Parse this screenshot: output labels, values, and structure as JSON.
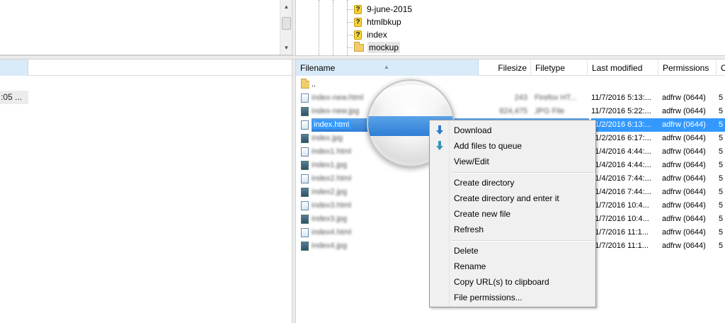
{
  "remote_tree": {
    "items": [
      {
        "label": "9-june-2015",
        "icon": "question-folder-icon"
      },
      {
        "label": "htmlbkup",
        "icon": "question-folder-icon"
      },
      {
        "label": "index",
        "icon": "question-folder-icon"
      },
      {
        "label": "mockup",
        "icon": "folder-icon"
      }
    ]
  },
  "local_list": {
    "cell_text": ":05 ..."
  },
  "file_list": {
    "columns": [
      "Filename",
      "Filesize",
      "Filetype",
      "Last modified",
      "Permissions",
      "O"
    ],
    "rows": [
      {
        "name": "..",
        "size": "",
        "type": "",
        "modified": "",
        "perms": "",
        "owner": "",
        "icon": "folder-icon"
      },
      {
        "name": "index-new.html",
        "size": "243",
        "type": "Firefox HT...",
        "modified": "11/7/2016 5:13:...",
        "perms": "adfrw (0644)",
        "owner": "5",
        "icon": "html-file-icon"
      },
      {
        "name": "index-new.jpg",
        "size": "824,475",
        "type": "JPG File",
        "modified": "11/7/2016 5:22:...",
        "perms": "adfrw (0644)",
        "owner": "5",
        "icon": "image-file-icon"
      },
      {
        "name": "index.html",
        "size": "",
        "type": "",
        "modified": "11/2/2016 6:13:...",
        "perms": "adfrw (0644)",
        "owner": "5",
        "icon": "html-file-icon"
      },
      {
        "name": "index.jpg",
        "size": "",
        "type": "",
        "modified": "11/2/2016 6:17:...",
        "perms": "adfrw (0644)",
        "owner": "5",
        "icon": "image-file-icon"
      },
      {
        "name": "index1.html",
        "size": "",
        "type": "",
        "modified": "11/4/2016 4:44:...",
        "perms": "adfrw (0644)",
        "owner": "5",
        "icon": "html-file-icon"
      },
      {
        "name": "index1.jpg",
        "size": "",
        "type": "",
        "modified": "11/4/2016 4:44:...",
        "perms": "adfrw (0644)",
        "owner": "5",
        "icon": "image-file-icon"
      },
      {
        "name": "index2.html",
        "size": "",
        "type": "",
        "modified": "11/4/2016 7:44:...",
        "perms": "adfrw (0644)",
        "owner": "5",
        "icon": "html-file-icon"
      },
      {
        "name": "index2.jpg",
        "size": "",
        "type": "",
        "modified": "11/4/2016 7:44:...",
        "perms": "adfrw (0644)",
        "owner": "5",
        "icon": "image-file-icon"
      },
      {
        "name": "index3.html",
        "size": "",
        "type": "",
        "modified": "11/7/2016 10:4...",
        "perms": "adfrw (0644)",
        "owner": "5",
        "icon": "html-file-icon"
      },
      {
        "name": "index3.jpg",
        "size": "",
        "type": "",
        "modified": "11/7/2016 10:4...",
        "perms": "adfrw (0644)",
        "owner": "5",
        "icon": "image-file-icon"
      },
      {
        "name": "index4.html",
        "size": "",
        "type": "",
        "modified": "11/7/2016 11:1...",
        "perms": "adfrw (0644)",
        "owner": "5",
        "icon": "html-file-icon"
      },
      {
        "name": "index4.jpg",
        "size": "",
        "type": "",
        "modified": "11/7/2016 11:1...",
        "perms": "adfrw (0644)",
        "owner": "5",
        "icon": "image-file-icon"
      }
    ],
    "selected_row": 3
  },
  "context_menu": {
    "download": "Download",
    "add_to_queue": "Add files to queue",
    "view_edit": "View/Edit",
    "create_directory": "Create directory",
    "create_directory_enter": "Create directory and enter it",
    "create_new_file": "Create new file",
    "refresh": "Refresh",
    "delete": "Delete",
    "rename": "Rename",
    "copy_url": "Copy URL(s) to clipboard",
    "file_permissions": "File permissions..."
  },
  "colors": {
    "selection": "#3399ff",
    "header_sorted": "#d9ebf9",
    "menu_bg": "#f0f0f0"
  }
}
